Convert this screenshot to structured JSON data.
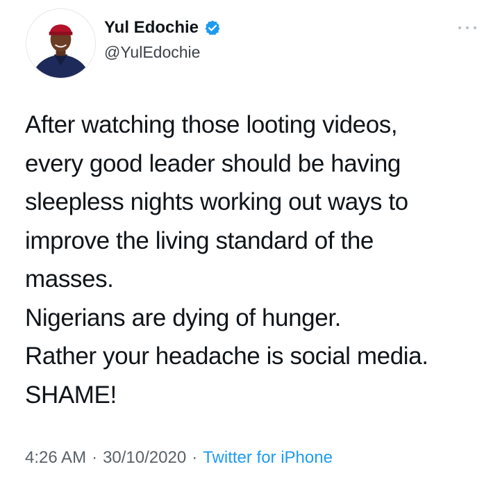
{
  "user": {
    "display_name": "Yul Edochie",
    "handle": "@YulEdochie",
    "verified": true
  },
  "tweet": {
    "lines": [
      "After watching those looting videos,",
      "every good leader should be having",
      "sleepless nights working out ways to",
      "improve the living standard of the",
      "masses.",
      "Nigerians are dying of hunger.",
      "Rather your headache is social media.",
      "SHAME!"
    ]
  },
  "meta": {
    "time": "4:26 AM",
    "separator": "·",
    "date": "30/10/2020",
    "source": "Twitter for iPhone"
  },
  "colors": {
    "verified_badge": "#1d9bf0",
    "link": "#1d9bf0",
    "muted_text": "#5b6168"
  },
  "icons": {
    "verified": "verified-badge-icon",
    "more": "more-dots-icon"
  }
}
